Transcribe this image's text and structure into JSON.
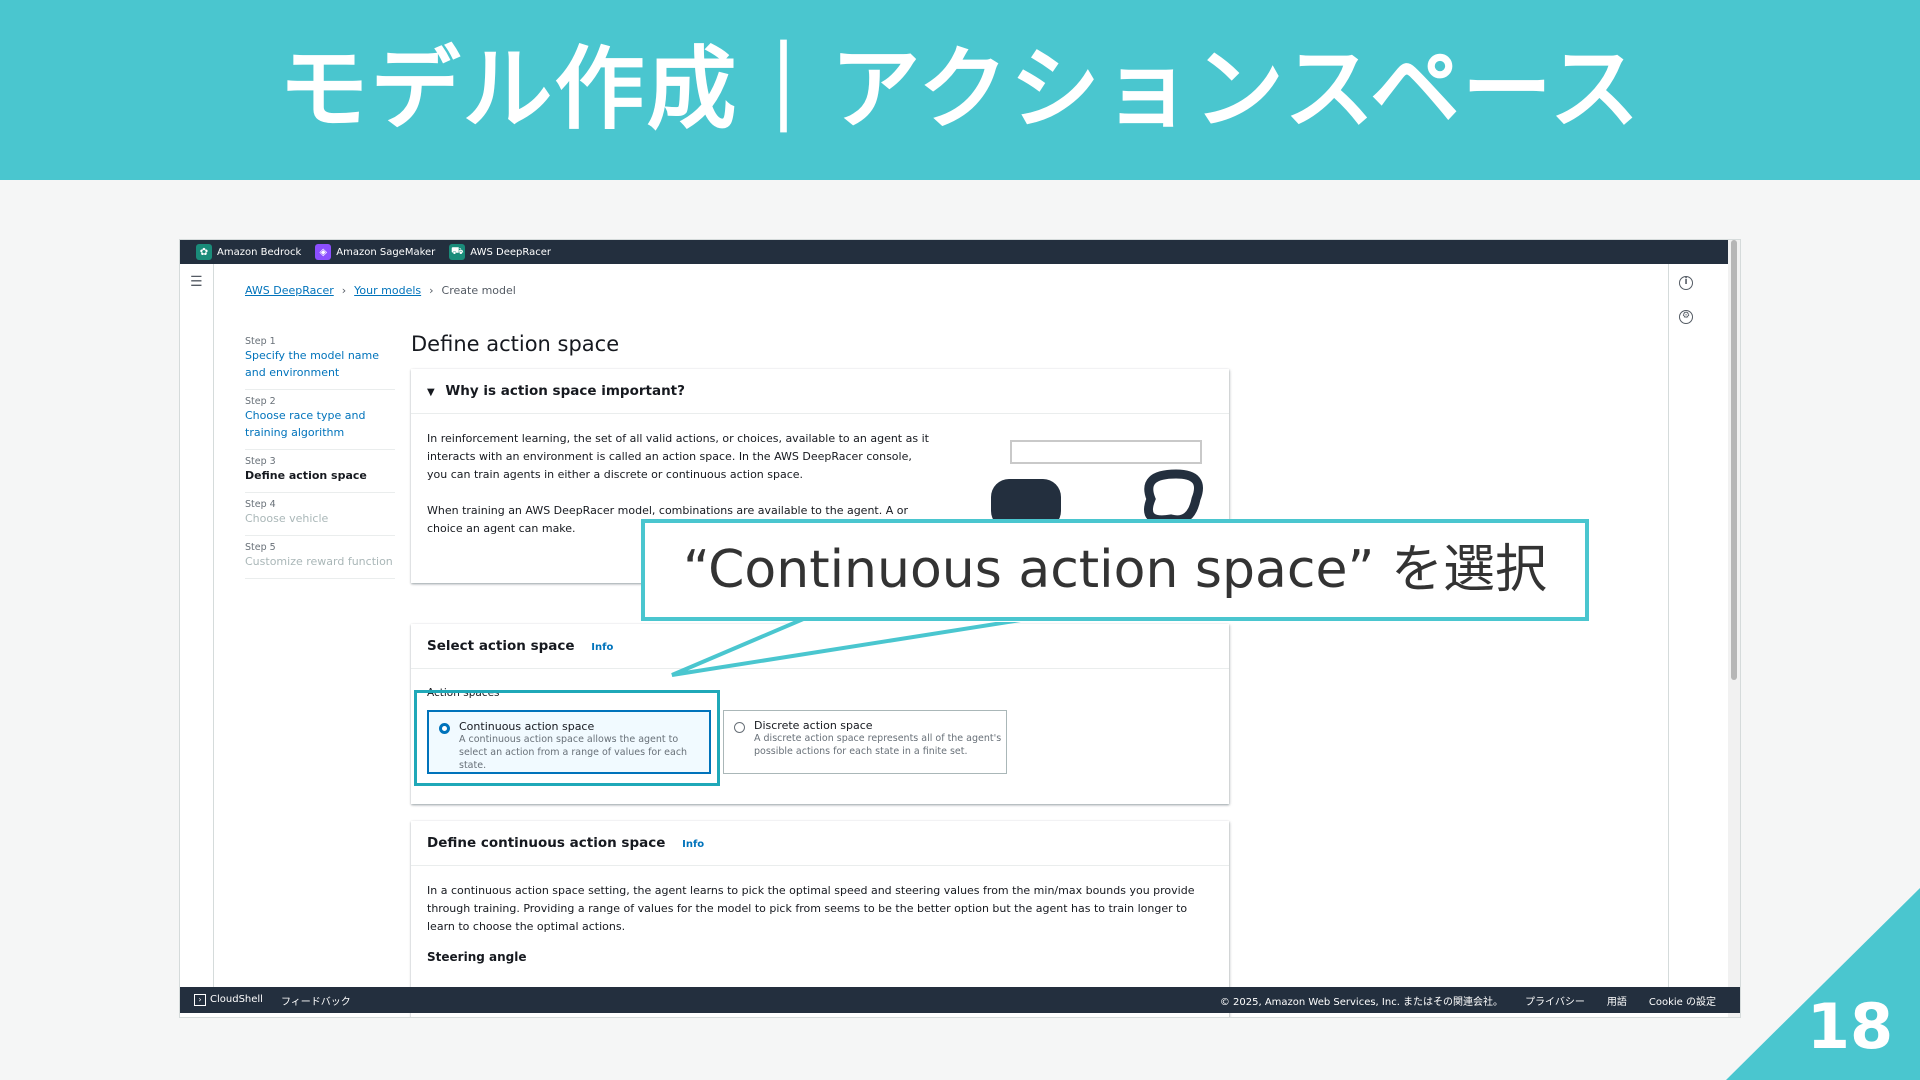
{
  "slide": {
    "title": "モデル作成｜アクションスペース",
    "page_number": "18",
    "callout": "“Continuous action space” を選択"
  },
  "colors": {
    "accent": "#4ac6cf",
    "aws_dark": "#232f3e",
    "link": "#0073bb"
  },
  "console": {
    "services": [
      {
        "label": "Amazon Bedrock",
        "icon": "bedrock-icon",
        "color": "#1a8c7a"
      },
      {
        "label": "Amazon SageMaker",
        "icon": "sagemaker-icon",
        "color": "#8c4fff"
      },
      {
        "label": "AWS DeepRacer",
        "icon": "deepracer-icon",
        "color": "#1a8c7a"
      }
    ],
    "breadcrumb": {
      "item1": "AWS DeepRacer",
      "item2": "Your models",
      "current": "Create model"
    },
    "steps": [
      {
        "no": "Step 1",
        "label": "Specify the model name and environment"
      },
      {
        "no": "Step 2",
        "label": "Choose race type and training algorithm"
      },
      {
        "no": "Step 3",
        "label": "Define action space"
      },
      {
        "no": "Step 4",
        "label": "Choose vehicle"
      },
      {
        "no": "Step 5",
        "label": "Customize reward function"
      }
    ],
    "page_heading": "Define action space",
    "why": {
      "heading": "Why is action space important?",
      "p1": "In reinforcement learning, the set of all valid actions, or choices, available to an agent as it interacts with an environment is called an action space. In the AWS DeepRacer console, you can train agents in either a discrete or continuous action space.",
      "p2": "When training an AWS DeepRacer model, combinations are available to the agent. A or choice an agent can make."
    },
    "select": {
      "heading": "Select action space",
      "info": "Info",
      "label": "Action spaces",
      "continuous_title": "Continuous action space",
      "continuous_desc": "A continuous action space allows the agent to select an action from a range of values for each state.",
      "discrete_title": "Discrete action space",
      "discrete_desc": "A discrete action space represents all of the agent's possible actions for each state in a finite set."
    },
    "continuous": {
      "heading": "Define continuous action space",
      "info": "Info",
      "body": "In a continuous action space setting, the agent learns to pick the optimal speed and steering values from the min/max bounds you provide through training. Providing a range of values for the model to pick from seems to be the better option but the agent has to train longer to learn to choose the optimal actions.",
      "steering": "Steering angle"
    },
    "footer": {
      "cloudshell": "CloudShell",
      "feedback": "フィードバック",
      "copyright": "© 2025, Amazon Web Services, Inc. またはその関連会社。",
      "privacy": "プライバシー",
      "terms": "用語",
      "cookie": "Cookie の設定"
    }
  }
}
